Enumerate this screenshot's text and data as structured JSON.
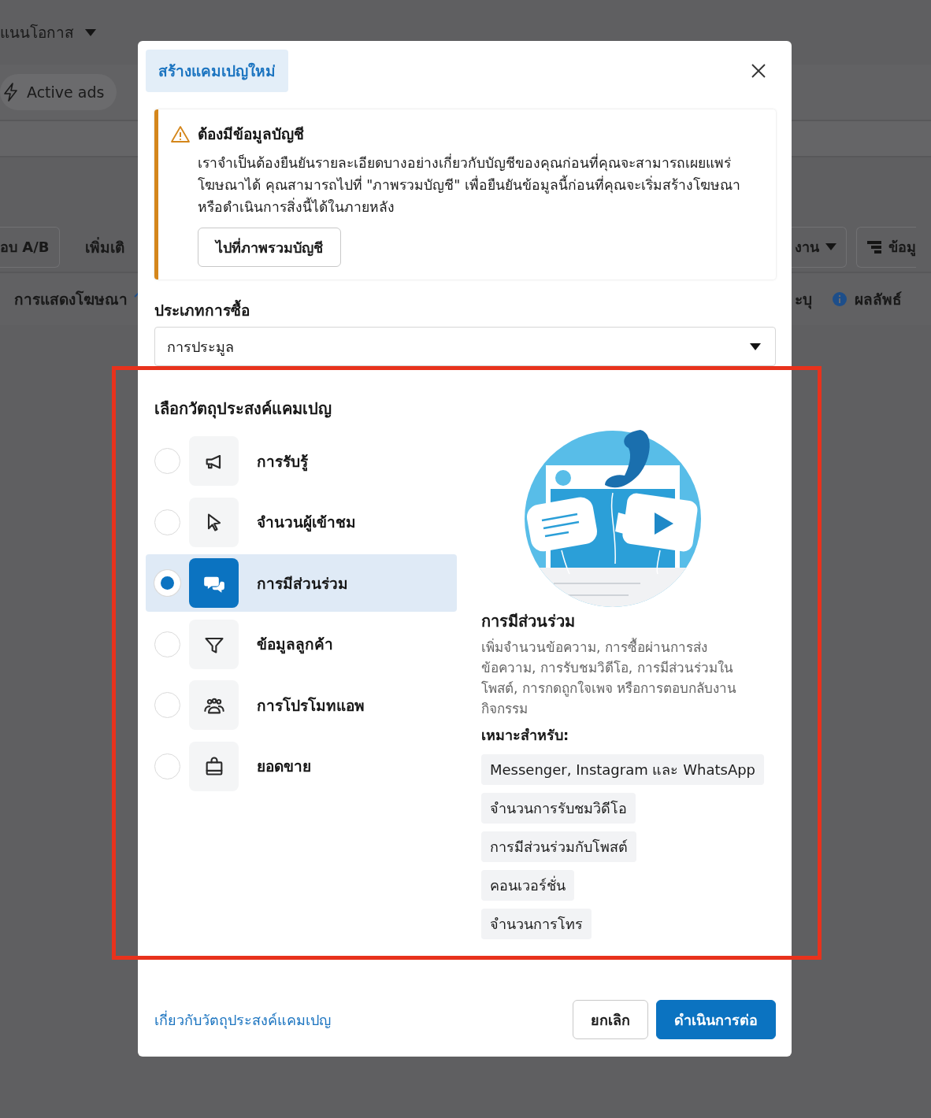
{
  "background": {
    "breadcrumb": "แนนโอกาส",
    "filter_chip": "Active ads",
    "toolbar_left": [
      "อบ A/B",
      "เพิ่มเติ"
    ],
    "toolbar_right": [
      "งาน",
      "ข้อมู"
    ],
    "columns_left": [
      "การแสดงโฆษณา"
    ],
    "columns_right": [
      "ะบุ",
      "ผลลัพธ์"
    ]
  },
  "modal": {
    "title": "สร้างแคมเปญใหม่",
    "warning": {
      "title": "ต้องมีข้อมูลบัญชี",
      "body": "เราจำเป็นต้องยืนยันรายละเอียดบางอย่างเกี่ยวกับบัญชีของคุณก่อนที่คุณจะสามารถเผยแพร่โฆษณาได้ คุณสามารถไปที่ \"ภาพรวมบัญชี\" เพื่อยืนยันข้อมูลนี้ก่อนที่คุณจะเริ่มสร้างโฆษณาหรือดำเนินการสิ่งนี้ได้ในภายหลัง",
      "button": "ไปที่ภาพรวมบัญชี"
    },
    "purchase_type": {
      "label": "ประเภทการซื้อ",
      "value": "การประมูล"
    },
    "objectives": {
      "title": "เลือกวัตถุประสงค์แคมเปญ",
      "options": [
        {
          "label": "การรับรู้",
          "selected": false
        },
        {
          "label": "จำนวนผู้เข้าชม",
          "selected": false
        },
        {
          "label": "การมีส่วนร่วม",
          "selected": true
        },
        {
          "label": "ข้อมูลลูกค้า",
          "selected": false
        },
        {
          "label": "การโปรโมทแอพ",
          "selected": false
        },
        {
          "label": "ยอดขาย",
          "selected": false
        }
      ]
    },
    "detail": {
      "title": "การมีส่วนร่วม",
      "description": "เพิ่มจำนวนข้อความ, การซื้อผ่านการส่งข้อความ, การรับชมวิดีโอ, การมีส่วนร่วมในโพสต์, การกดถูกใจเพจ หรือการตอบกลับงานกิจกรรม",
      "suited_label": "เหมาะสำหรับ:",
      "tags": [
        "Messenger, Instagram และ WhatsApp",
        "จำนวนการรับชมวิดีโอ",
        "การมีส่วนร่วมกับโพสต์",
        "คอนเวอร์ชั่น",
        "จำนวนการโทร"
      ]
    },
    "footer": {
      "link": "เกี่ยวกับวัตถุประสงค์แคมเปญ",
      "cancel": "ยกเลิก",
      "continue": "ดำเนินการต่อ"
    }
  }
}
